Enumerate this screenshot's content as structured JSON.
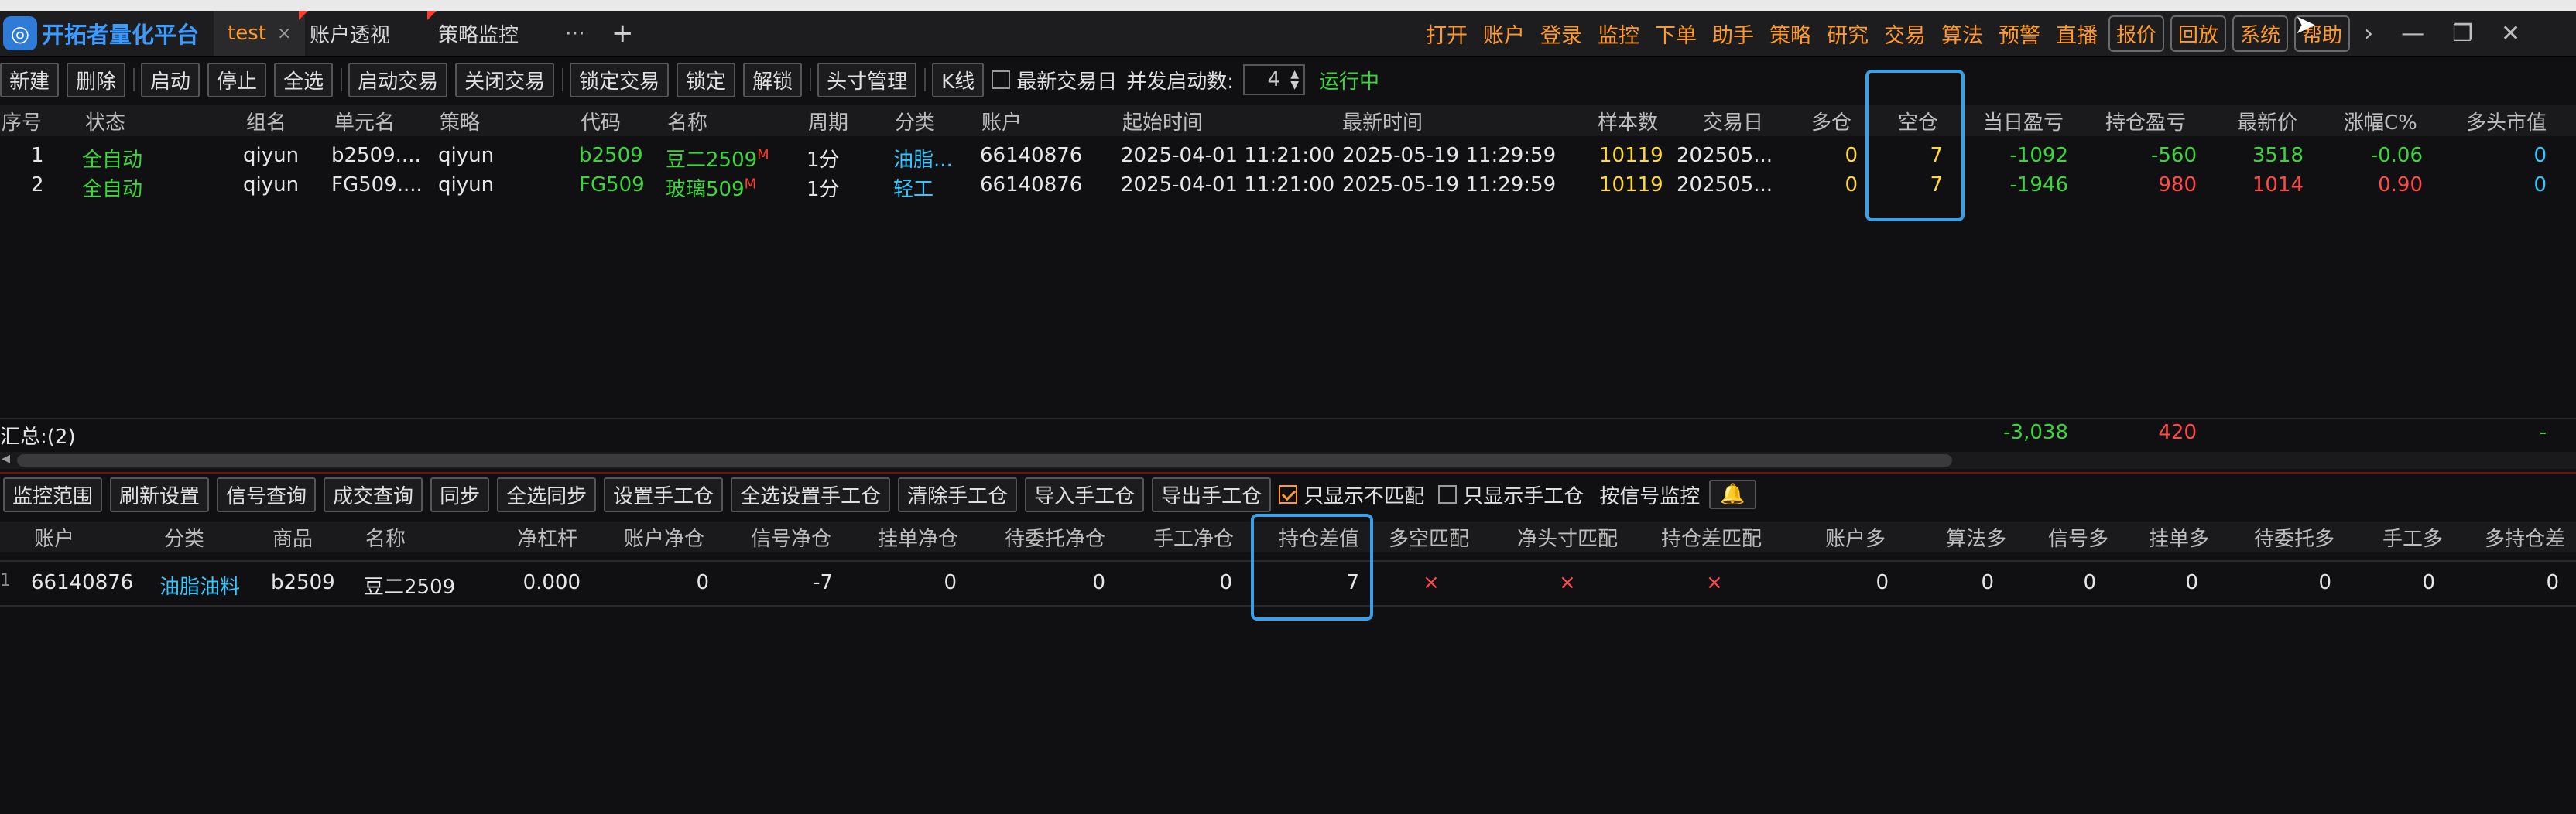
{
  "app": {
    "title": "开拓者量化平台",
    "tabs": [
      {
        "label": "test",
        "close": "×"
      },
      {
        "label": "账户透视"
      },
      {
        "label": "策略监控"
      }
    ],
    "more": "⋯",
    "add": "+",
    "menu": [
      "打开",
      "账户",
      "登录",
      "监控",
      "下单",
      "助手",
      "策略",
      "研究",
      "交易",
      "算法",
      "预警",
      "直播"
    ],
    "menu_buttons": [
      "报价",
      "回放",
      "系统",
      "帮助"
    ]
  },
  "toolbar1": {
    "buttons": [
      "新建",
      "删除",
      "启动",
      "停止",
      "全选",
      "启动交易",
      "关闭交易",
      "锁定交易",
      "锁定",
      "解锁",
      "头寸管理",
      "K线"
    ],
    "latest_trading_day": "最新交易日",
    "concurrency_label": "并发启动数:",
    "concurrency_value": "4",
    "status": "运行中"
  },
  "grid1": {
    "headers": [
      "序号",
      "状态",
      "组名",
      "单元名",
      "策略",
      "代码",
      "名称",
      "周期",
      "分类",
      "账户",
      "起始时间",
      "最新时间",
      "样本数",
      "交易日",
      "多仓",
      "空仓",
      "当日盈亏",
      "持仓盈亏",
      "最新价",
      "涨幅C%",
      "多头市值"
    ],
    "rows": [
      {
        "no": "1",
        "status": "全自动",
        "group": "qiyun",
        "unit": "b2509....",
        "strategy": "qiyun",
        "code": "b2509",
        "name": "豆二2509",
        "mark": "M",
        "period": "1分",
        "category": "油脂...",
        "account": "66140876",
        "start": "2025-04-01 11:21:00",
        "latest": "2025-05-19 11:29:59",
        "samples": "10119",
        "tradeday": "202505...",
        "long": "0",
        "short": "7",
        "daypnl": "-1092",
        "pospnl": "-560",
        "price": "3518",
        "change": "-0.06",
        "longval": "0"
      },
      {
        "no": "2",
        "status": "全自动",
        "group": "qiyun",
        "unit": "FG509....",
        "strategy": "qiyun",
        "code": "FG509",
        "name": "玻璃509",
        "mark": "M",
        "period": "1分",
        "category": "轻工",
        "account": "66140876",
        "start": "2025-04-01 11:21:00",
        "latest": "2025-05-19 11:29:59",
        "samples": "10119",
        "tradeday": "202505...",
        "long": "0",
        "short": "7",
        "daypnl": "-1946",
        "pospnl": "980",
        "price": "1014",
        "change": "0.90",
        "longval": "0"
      }
    ],
    "summary_label": "汇总:(2)",
    "summary_daypnl": "-3,038",
    "summary_pospnl": "420",
    "summary_longval": "-"
  },
  "toolbar2": {
    "buttons": [
      "监控范围",
      "刷新设置",
      "信号查询",
      "成交查询",
      "同步",
      "全选同步",
      "设置手工仓",
      "全选设置手工仓",
      "清除手工仓",
      "导入手工仓",
      "导出手工仓"
    ],
    "only_mismatch": "只显示不匹配",
    "only_manual": "只显示手工仓",
    "signal_monitor": "按信号监控"
  },
  "grid2": {
    "headers": [
      "账户",
      "分类",
      "商品",
      "名称",
      "净杠杆",
      "账户净仓",
      "信号净仓",
      "挂单净仓",
      "待委托净仓",
      "手工净仓",
      "持仓差值",
      "多空匹配",
      "净头寸匹配",
      "持仓差匹配",
      "账户多",
      "算法多",
      "信号多",
      "挂单多",
      "待委托多",
      "手工多",
      "多持仓差"
    ],
    "rows": [
      {
        "no": "1",
        "account": "66140876",
        "category": "油脂油料",
        "product": "b2509",
        "name": "豆二2509",
        "leverage": "0.000",
        "acct_net": "0",
        "signal_net": "-7",
        "pending_net": "0",
        "towait_net": "0",
        "manual_net": "0",
        "pos_diff": "7",
        "ls_match": "×",
        "net_match": "×",
        "diff_match": "×",
        "acct_long": "0",
        "algo_long": "0",
        "signal_long": "0",
        "pending_long": "0",
        "towait_long": "0",
        "manual_long": "0",
        "long_diff": "0"
      }
    ]
  },
  "colors": {
    "accent": "#ff9a2a",
    "positive": "#3cd53c",
    "negative": "#ff4a4a",
    "info": "#35c8ff",
    "highlight": "#3aa0e8"
  }
}
